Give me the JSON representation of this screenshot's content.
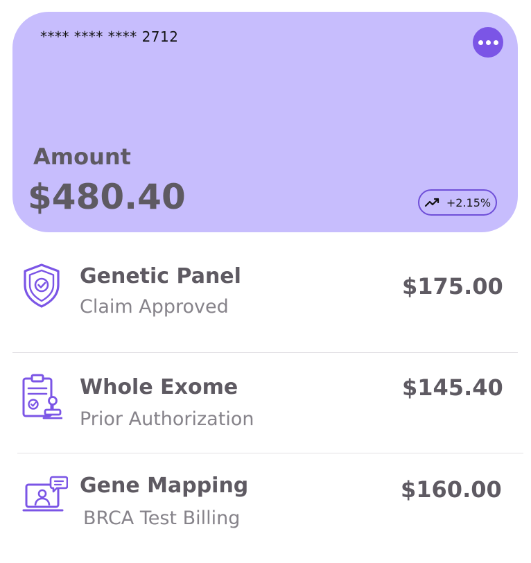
{
  "card": {
    "number": "**** **** **** 2712",
    "amount_label": "Amount",
    "amount_value": "$480.40",
    "trend": "+2.15%",
    "accent_color": "#7b55e6",
    "background_color": "#c7bdfd"
  },
  "items": [
    {
      "icon": "shield-check-icon",
      "title": "Genetic Panel",
      "subtitle": "Claim Approved",
      "amount": "$175.00"
    },
    {
      "icon": "clipboard-stamp-icon",
      "title": "Whole Exome",
      "subtitle": "Prior Authorization",
      "amount": "$145.40"
    },
    {
      "icon": "video-consultation-icon",
      "title": "Gene Mapping",
      "subtitle": "BRCA Test Billing",
      "amount": "$160.00"
    }
  ]
}
